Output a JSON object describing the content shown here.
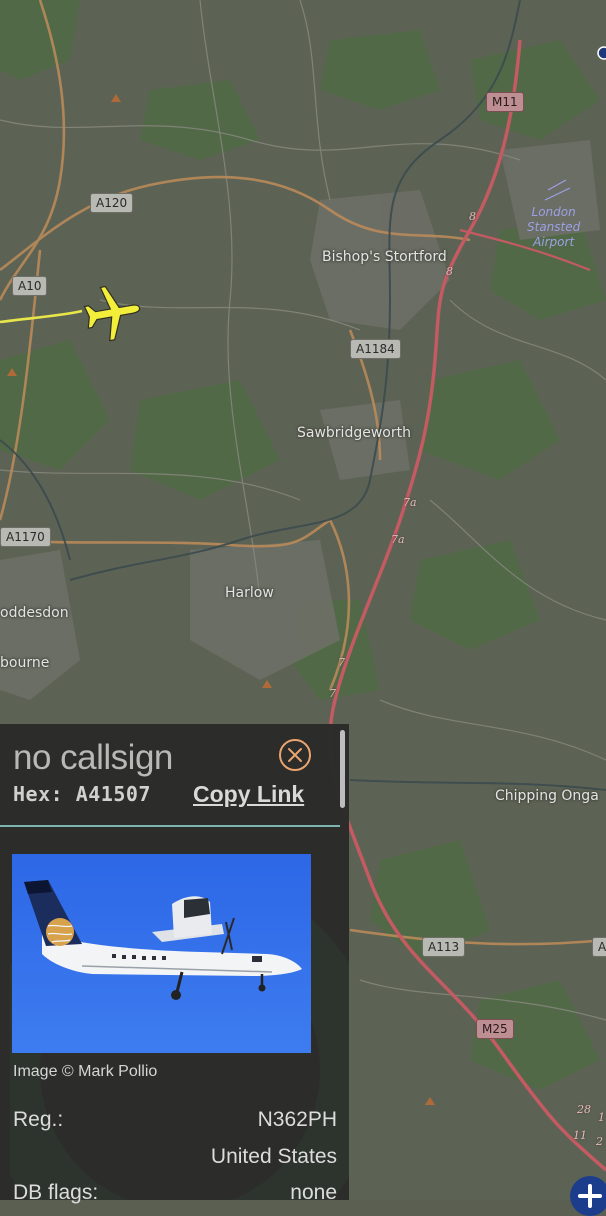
{
  "map": {
    "labels": {
      "bishops_stortford": "Bishop's Stortford",
      "sawbridgeworth": "Sawbridgeworth",
      "harlow": "Harlow",
      "hoddesdon": "oddesdon",
      "broxbourne": "bourne",
      "chipping_ongar": "Chipping Onga",
      "airport_line1": "London",
      "airport_line2": "Stansted",
      "airport_line3": "Airport"
    },
    "roads": {
      "a120": "A120",
      "a10": "A10",
      "a1184": "A1184",
      "a1170": "A1170",
      "a113": "A113",
      "m11": "M11",
      "m25": "M25",
      "a12x": "A"
    },
    "junctions": {
      "j8a": "8",
      "j8b": "8",
      "j7a_1": "7a",
      "j7a_2": "7a",
      "j7_1": "7",
      "j7_2": "7",
      "j28": "28",
      "j11": "11",
      "j1": "1",
      "j2": "2"
    },
    "aircraft_color": "#f3ee3a",
    "track_color": "#e8e64a"
  },
  "panel": {
    "callsign": "no callsign",
    "hex_label": "Hex:",
    "hex_value": "A41507",
    "copy_link": "Copy Link",
    "image_credit": "Image © Mark Pollio",
    "reg_label": "Reg.:",
    "reg_value": "N362PH",
    "country_value": "United States",
    "db_flags_label": "DB flags:",
    "db_flags_value": "none",
    "accent_color": "#e9a56f"
  }
}
